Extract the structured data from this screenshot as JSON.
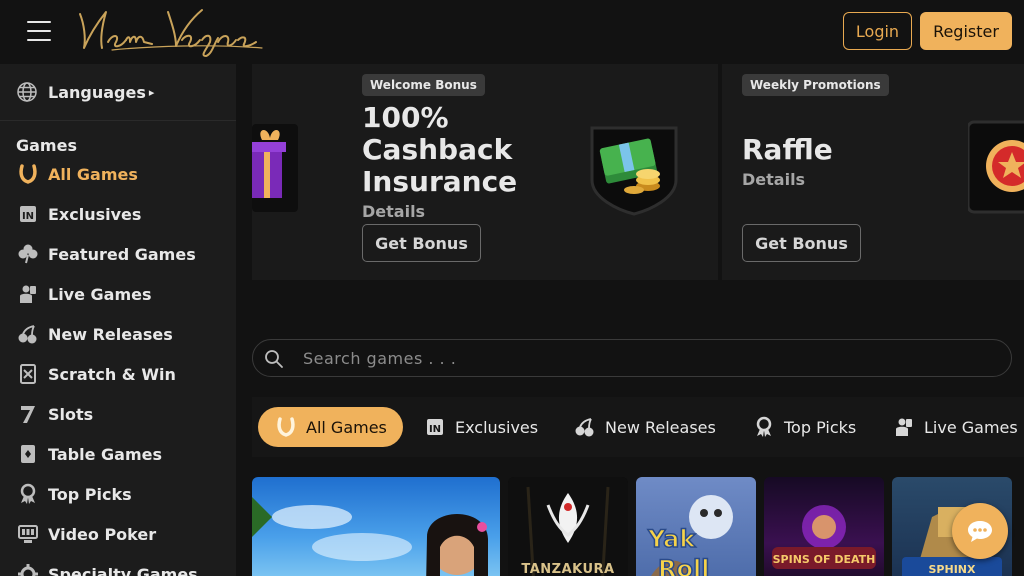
{
  "header": {
    "logo_text": "New Vegas",
    "login_label": "Login",
    "register_label": "Register"
  },
  "sidebar": {
    "languages_label": "Languages",
    "games_heading": "Games",
    "items": [
      {
        "label": "All Games",
        "icon": "horseshoe-icon",
        "active": true
      },
      {
        "label": "Exclusives",
        "icon": "exclusive-badge-icon",
        "active": false
      },
      {
        "label": "Featured Games",
        "icon": "clover-icon",
        "active": false
      },
      {
        "label": "Live Games",
        "icon": "live-dealer-icon",
        "active": false
      },
      {
        "label": "New Releases",
        "icon": "cherries-icon",
        "active": false
      },
      {
        "label": "Scratch & Win",
        "icon": "scratch-card-icon",
        "active": false
      },
      {
        "label": "Slots",
        "icon": "seven-icon",
        "active": false
      },
      {
        "label": "Table Games",
        "icon": "playing-card-icon",
        "active": false
      },
      {
        "label": "Top Picks",
        "icon": "award-icon",
        "active": false
      },
      {
        "label": "Video Poker",
        "icon": "video-poker-icon",
        "active": false
      },
      {
        "label": "Specialty Games",
        "icon": "gear-icon",
        "active": false
      }
    ]
  },
  "carousel": {
    "slides": [
      {
        "badge": "Welcome Bonus",
        "title_lines": [
          "100%",
          "Cashback",
          "Insurance"
        ],
        "details": "Details",
        "button": "Get Bonus",
        "icon": "cash-stack-icon"
      },
      {
        "badge": "Weekly Promotions",
        "title_lines": [
          "Raffle"
        ],
        "details": "Details",
        "button": "Get Bonus",
        "icon": "raffle-ticket-icon"
      }
    ],
    "dot_count": 3,
    "active_dot": 0
  },
  "search": {
    "placeholder": "Search games . . ."
  },
  "tabs": [
    {
      "label": "All Games",
      "icon": "horseshoe-icon",
      "active": true
    },
    {
      "label": "Exclusives",
      "icon": "exclusive-badge-icon",
      "active": false
    },
    {
      "label": "New Releases",
      "icon": "cherries-icon",
      "active": false
    },
    {
      "label": "Top Picks",
      "icon": "award-icon",
      "active": false
    },
    {
      "label": "Live Games",
      "icon": "live-dealer-icon",
      "active": false
    }
  ],
  "games": [
    {
      "title": "",
      "theme": "asian-woman-sky"
    },
    {
      "title": "TANZAKURA",
      "theme": "tanzakura"
    },
    {
      "title": "Yak Yeti and Roll",
      "theme": "yak-yeti-roll"
    },
    {
      "title": "Spins of Death",
      "theme": "spins-of-death"
    },
    {
      "title": "Sphinx",
      "theme": "sphinx"
    }
  ],
  "colors": {
    "accent": "#f0b25c",
    "background": "#121212",
    "sidebar": "#1c1c1c"
  }
}
